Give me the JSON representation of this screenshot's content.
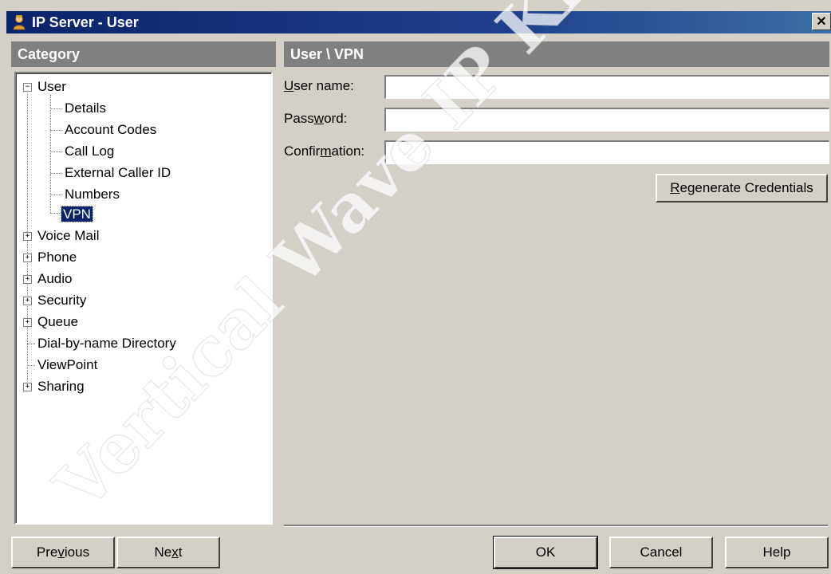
{
  "window": {
    "title": "IP Server - User",
    "close_label": "✕"
  },
  "category_header": "Category",
  "content_header": "User \\ VPN",
  "tree": {
    "root_label": "User",
    "root_expander": "−",
    "children": [
      "Details",
      "Account Codes",
      "Call Log",
      "External Caller ID",
      "Numbers",
      "VPN"
    ],
    "selected": "VPN",
    "siblings": [
      {
        "label": "Voice Mail",
        "expander": "+"
      },
      {
        "label": "Phone",
        "expander": "+"
      },
      {
        "label": "Audio",
        "expander": "+"
      },
      {
        "label": "Security",
        "expander": "+"
      },
      {
        "label": "Queue",
        "expander": "+"
      },
      {
        "label": "Dial-by-name Directory",
        "expander": ""
      },
      {
        "label": "ViewPoint",
        "expander": ""
      },
      {
        "label": "Sharing",
        "expander": "+"
      }
    ]
  },
  "form": {
    "username_label_u": "U",
    "username_label_rest": "ser name:",
    "username_value": "",
    "password_label_pre": "Pass",
    "password_label_u": "w",
    "password_label_rest": "ord:",
    "password_value": "",
    "confirm_label_pre": "Confir",
    "confirm_label_u": "m",
    "confirm_label_rest": "ation:",
    "confirm_value": "",
    "regenerate_u": "R",
    "regenerate_rest": "egenerate Credentials"
  },
  "buttons": {
    "previous_pre": "Pre",
    "previous_u": "v",
    "previous_rest": "ious",
    "next_pre": "Ne",
    "next_u": "x",
    "next_rest": "t",
    "ok": "OK",
    "cancel": "Cancel",
    "help": "Help"
  },
  "watermark": "Vertical Wave IP Knowledge",
  "icons": {
    "app": "user-server-icon",
    "close": "close-icon"
  }
}
